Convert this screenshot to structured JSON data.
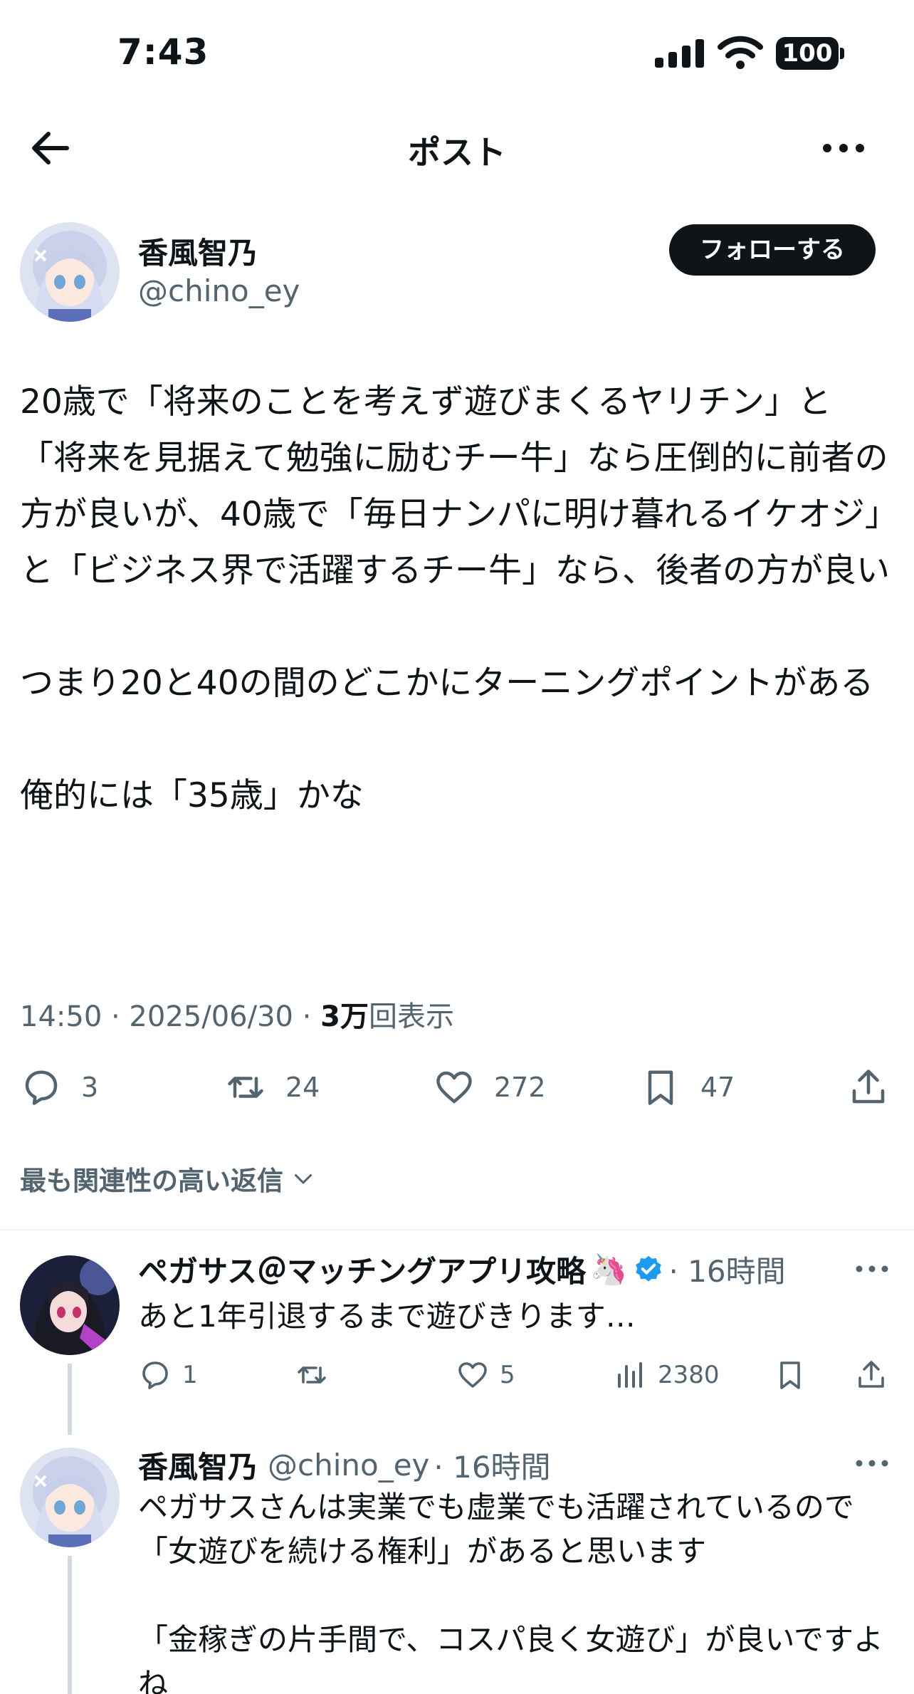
{
  "status_bar": {
    "time": "7:43",
    "battery": "100"
  },
  "header": {
    "title": "ポスト"
  },
  "post": {
    "author_name": "香風智乃",
    "author_handle": "@chino_ey",
    "follow_label": "フォローする",
    "text": "20歳で「将来のことを考えず遊びまくるヤリチン」と「将来を見据えて勉強に励むチー牛」なら圧倒的に前者の方が良いが、40歳で「毎日ナンパに明け暮れるイケオジ」と「ビジネス界で活躍するチー牛」なら、後者の方が良い\n\nつまり20と40の間のどこかにターニングポイントがある\n\n俺的には「35歳」かな",
    "time": "14:50 · 2025/06/30 · ",
    "views_count": "3万",
    "views_label": "回表示",
    "reply_count": "3",
    "repost_count": "24",
    "like_count": "272",
    "bookmark_count": "47"
  },
  "sort_label": "最も関連性の高い返信",
  "replies": [
    {
      "name": "ペガサス＠マッチングアプリ攻略",
      "emoji": "🦄",
      "meta": "· 16時間",
      "text": "あと1年引退するまで遊びきります…",
      "reply_count": "1",
      "like_count": "5",
      "view_count": "2380"
    },
    {
      "name": "香風智乃",
      "handle": "@chino_ey",
      "meta": "· 16時間",
      "text": "ペガサスさんは実業でも虚業でも活躍されているので「女遊びを続ける権利」があると思います\n\n「金稼ぎの片手間で、コスパ良く女遊び」が良いですよね"
    }
  ],
  "colors": {
    "text": "#0f1419",
    "secondary": "#536471",
    "verified": "#1d9bf0"
  }
}
